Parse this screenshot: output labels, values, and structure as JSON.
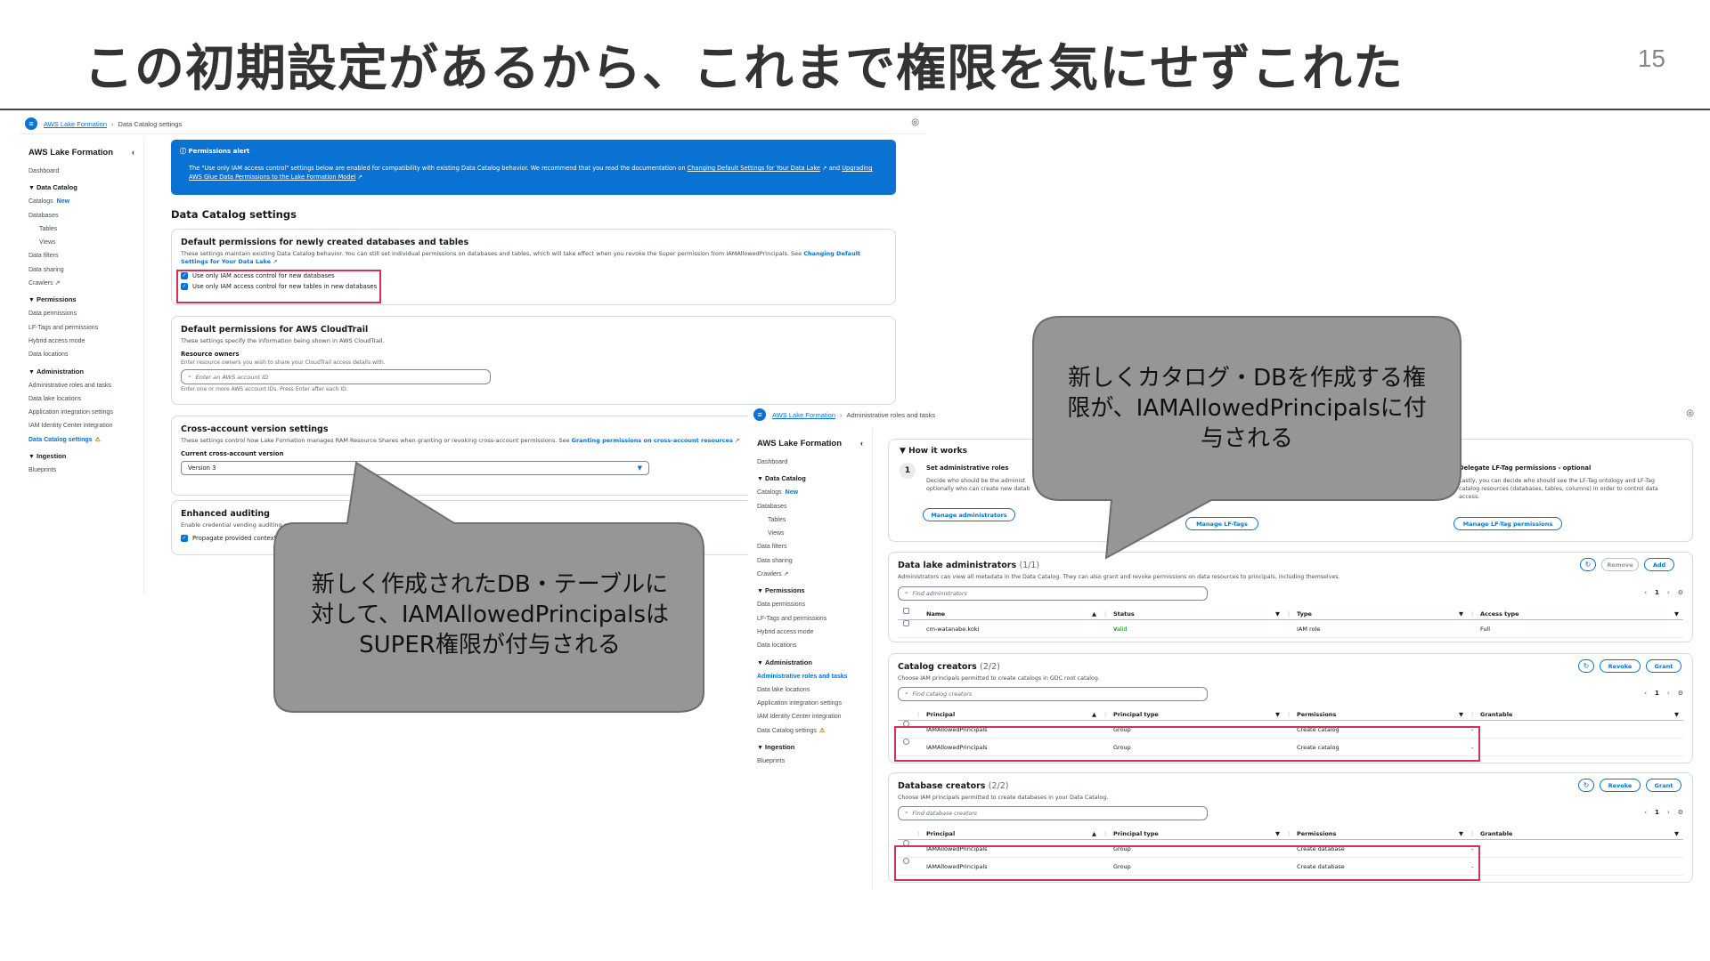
{
  "slide": {
    "title": "この初期設定があるから、これまで権限を気にせずこれた",
    "page_number": "15"
  },
  "left_console": {
    "menu_icon": "menu-icon",
    "breadcrumb": {
      "root": "AWS Lake Formation",
      "current": "Data Catalog settings"
    },
    "sidebar": {
      "title": "AWS Lake Formation",
      "dashboard": "Dashboard",
      "data_catalog": "Data Catalog",
      "catalogs": "Catalogs",
      "new_badge": "New",
      "databases": "Databases",
      "tables": "Tables",
      "views": "Views",
      "data_filters": "Data filters",
      "data_sharing": "Data sharing",
      "crawlers": "Crawlers",
      "permissions": "Permissions",
      "data_permissions": "Data permissions",
      "lf_tags": "LF-Tags and permissions",
      "hybrid": "Hybrid access mode",
      "data_locations": "Data locations",
      "administration": "Administration",
      "admin_roles": "Administrative roles and tasks",
      "lake_locations": "Data lake locations",
      "app_integration": "Application integration settings",
      "iam_ic": "IAM Identity Center integration",
      "catalog_settings": "Data Catalog settings",
      "ingestion": "Ingestion",
      "blueprints": "Blueprints"
    },
    "alert": {
      "title": "Permissions alert",
      "body_1": "The \"Use only IAM access control\" settings below are enabled for compatibility with existing Data Catalog behavior. We recommend that you read the documentation on ",
      "link_1": "Changing Default Settings for Your Data Lake",
      "body_2": " and ",
      "link_2": "Upgrading AWS Glue Data Permissions to the Lake Formation Model"
    },
    "section_heading": "Data Catalog settings",
    "default_perms": {
      "title": "Default permissions for newly created databases and tables",
      "desc": "These settings maintain existing Data Catalog behavior. You can still set individual permissions on databases and tables, which will take effect when you revoke the Super permission from IAMAllowedPrincipals. See ",
      "desc_link": "Changing Default Settings for Your Data Lake",
      "checkbox_1": "Use only IAM access control for new databases",
      "checkbox_2": "Use only IAM access control for new tables in new databases"
    },
    "cloudtrail": {
      "title": "Default permissions for AWS CloudTrail",
      "desc": "These settings specify the information being shown in AWS CloudTrail.",
      "field_label": "Resource owners",
      "field_hint": "Enter resource owners you wish to share your CloudTrail access details with.",
      "placeholder": "Enter an AWS account ID",
      "footer_hint": "Enter one or more AWS account IDs. Press Enter after each ID."
    },
    "cross_account": {
      "title": "Cross-account version settings",
      "desc": "These settings control how Lake Formation manages RAM Resource Shares when granting or revoking cross-account permissions. See ",
      "desc_link": "Granting permissions on cross-account resources",
      "field_label": "Current cross-account version",
      "selected": "Version 3"
    },
    "auditing": {
      "title": "Enhanced auditing",
      "desc": "Enable credential vending auditing on",
      "checkbox": "Propagate provided context"
    }
  },
  "right_console": {
    "breadcrumb": {
      "root": "AWS Lake Formation",
      "current": "Administrative roles and tasks"
    },
    "how_it_works": {
      "title": "How it works",
      "step1_num": "1",
      "step1_title": "Set administrative roles",
      "step1_desc_1": "Decide who should be the administ",
      "step1_desc_2": "optionally who can create new datab",
      "manage_admins": "Manage administrators",
      "manage_lf_tags": "Manage LF-Tags",
      "step3_title": "Delegate LF-Tag permissions - optional",
      "step3_desc_1": "Lastly, you can decide who should see the LF-Tag ontology and LF-Tag",
      "step3_desc_2": "catalog resources (databases, tables, columns) in order to control data",
      "step3_desc_3": "access.",
      "manage_lf_perms": "Manage LF-Tag permissions"
    },
    "admins": {
      "title": "Data lake administrators",
      "count": "(1/1)",
      "desc": "Administrators can view all metadata in the Data Catalog. They can also grant and revoke permissions on data resources to principals, including themselves.",
      "placeholder": "Find administrators",
      "remove": "Remove",
      "add": "Add",
      "page": "1",
      "columns": [
        "Name",
        "Status",
        "Type",
        "Access type"
      ],
      "rows": [
        [
          "cm-watanabe.koki",
          "Valid",
          "IAM role",
          "Full"
        ]
      ]
    },
    "catalog_creators": {
      "title": "Catalog creators",
      "count": "(2/2)",
      "desc": "Choose IAM principals permitted to create catalogs in GDC root catalog.",
      "placeholder": "Find catalog creators",
      "revoke": "Revoke",
      "grant": "Grant",
      "page": "1",
      "columns": [
        "Principal",
        "Principal type",
        "Permissions",
        "Grantable"
      ],
      "rows": [
        [
          "IAMAllowedPrincipals",
          "Group",
          "Create catalog",
          "-"
        ],
        [
          "IAMAllowedPrincipals",
          "Group",
          "Create catalog",
          "-"
        ]
      ]
    },
    "database_creators": {
      "title": "Database creators",
      "count": "(2/2)",
      "desc": "Choose IAM principals permitted to create databases in your Data Catalog.",
      "placeholder": "Find database creators",
      "revoke": "Revoke",
      "grant": "Grant",
      "page": "1",
      "columns": [
        "Principal",
        "Principal type",
        "Permissions",
        "Grantable"
      ],
      "rows": [
        [
          "IAMAllowedPrincipals",
          "Group",
          "Create database",
          "-"
        ],
        [
          "IAMAllowedPrincipals",
          "Group",
          "Create database",
          "-"
        ]
      ]
    }
  },
  "callouts": {
    "left": [
      "新しく作成されたDB・テーブルに",
      "対して、IAMAllowedPrincipalsは",
      "SUPER権限が付与される"
    ],
    "right": [
      "新しくカタログ・DBを作成する権",
      "限が、IAMAllowedPrincipalsに付",
      "与される"
    ]
  },
  "colors": {
    "accent": "#0972d3",
    "highlight_box": "#d0325a",
    "callout_fill": "#969696"
  }
}
